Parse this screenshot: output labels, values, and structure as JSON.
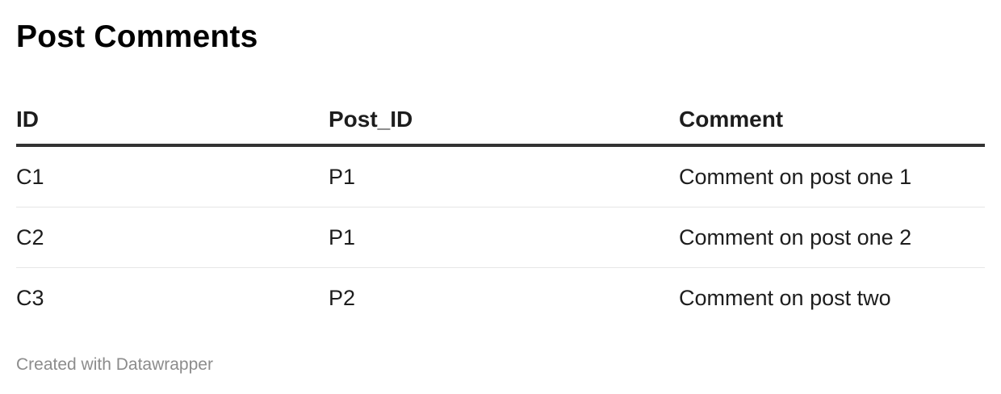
{
  "chart_data": {
    "type": "table",
    "title": "Post Comments",
    "columns": [
      "ID",
      "Post_ID",
      "Comment"
    ],
    "rows": [
      [
        "C1",
        "P1",
        "Comment on post one 1"
      ],
      [
        "C2",
        "P1",
        "Comment on post one 2"
      ],
      [
        "C3",
        "P2",
        "Comment on post two"
      ]
    ]
  },
  "footer": {
    "credit": "Created with Datawrapper"
  },
  "colors": {
    "header_rule": "#333333",
    "row_rule": "#e6e6e6",
    "footer_text": "#8c8c8c"
  }
}
